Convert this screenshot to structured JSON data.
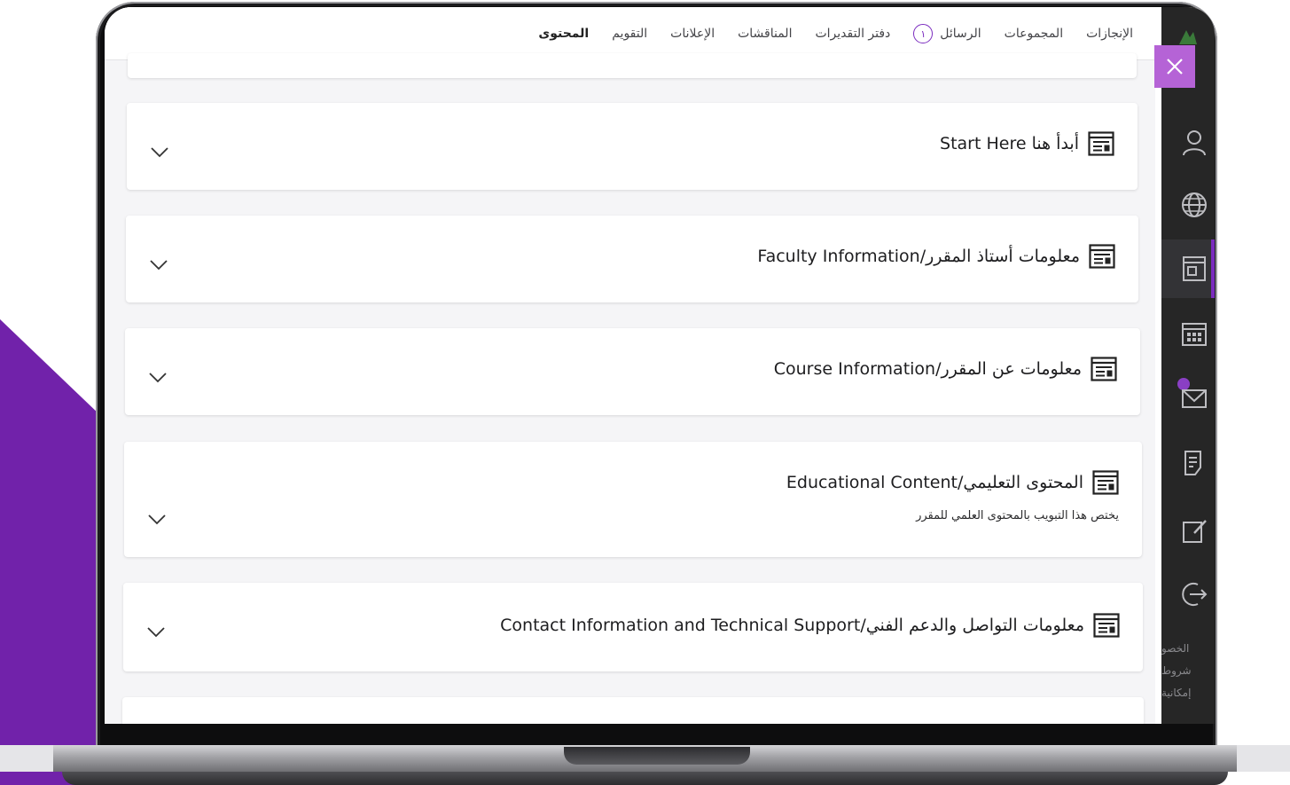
{
  "colors": {
    "accent": "#7b2cbf",
    "decor": "#6a1b9a",
    "close": "#b563d6",
    "rail": "#262626",
    "panel": "#f5f5f7"
  },
  "tabs": [
    {
      "label": "المحتوى",
      "active": true
    },
    {
      "label": "التقويم"
    },
    {
      "label": "الإعلانات"
    },
    {
      "label": "المناقشات"
    },
    {
      "label": "دفتر التقديرات"
    },
    {
      "label": "الرسائل",
      "badge": "١"
    },
    {
      "label": "المجموعات"
    },
    {
      "label": "الإنجازات"
    }
  ],
  "close_icon": "close-icon",
  "rail": {
    "icons": [
      "user-icon",
      "globe-icon",
      "course-icon",
      "calendar-icon",
      "mail-icon",
      "grades-icon",
      "edit-icon",
      "logout-icon"
    ],
    "footer": [
      "الخصو",
      "شروط",
      "إمكانية"
    ]
  },
  "items": [
    {
      "title": "أبدأ هنا Start Here",
      "icon": "document-icon"
    },
    {
      "title": "معلومات أستاذ المقرر/Faculty Information",
      "icon": "document-icon"
    },
    {
      "title": "معلومات عن المقرر/Course Information",
      "icon": "document-icon"
    },
    {
      "title": "المحتوى التعليمي/Educational Content",
      "subtitle": "يختص هذا التبويب بالمحتوى العلمي للمقرر",
      "icon": "document-icon"
    },
    {
      "title": "معلومات التواصل والدعم الفني/Contact Information and Technical Support",
      "icon": "document-icon"
    }
  ]
}
